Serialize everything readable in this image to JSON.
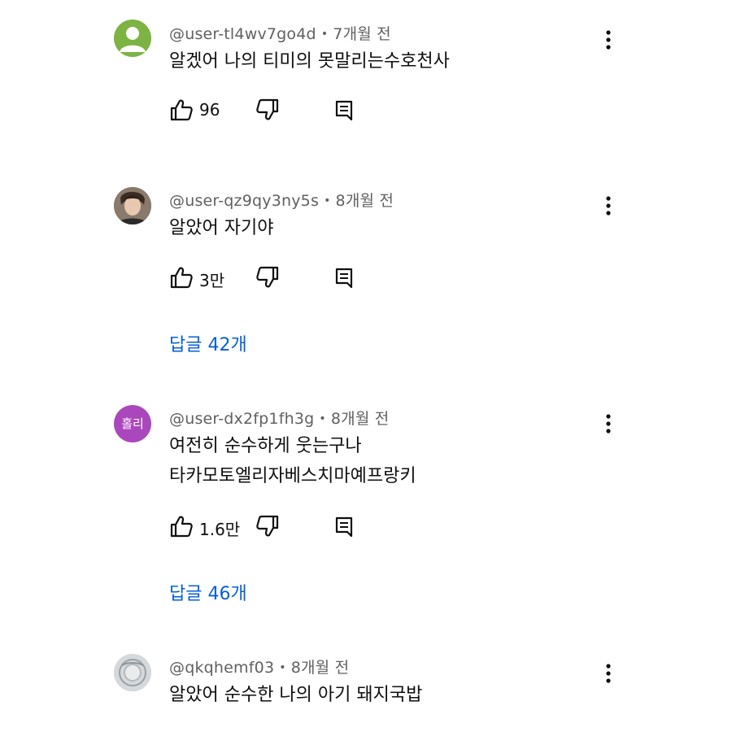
{
  "colors": {
    "link": "#065fd4",
    "meta": "#606060",
    "text": "#0f0f0f"
  },
  "comments": [
    {
      "username": "@user-tl4wv7go4d",
      "time": "7개월 전",
      "lines": [
        "알겠어 나의 티미의 못말리는수호천사"
      ],
      "likes": "96",
      "avatar": {
        "type": "default-person-icon",
        "color": "#7cb342"
      }
    },
    {
      "username": "@user-qz9qy3ny5s",
      "time": "8개월 전",
      "lines": [
        "알았어 자기야"
      ],
      "likes": "3만",
      "replies": "답글 42개",
      "avatar": {
        "type": "photo-avatar"
      }
    },
    {
      "username": "@user-dx2fp1fh3g",
      "time": "8개월 전",
      "lines": [
        "여전히 순수하게 웃는구나",
        "타카모토엘리자베스치마예프랑키"
      ],
      "likes": "1.6만",
      "replies": "답글 46개",
      "avatar": {
        "type": "text-avatar",
        "text": "홀리",
        "color": "#ab47bc"
      }
    },
    {
      "username": "@qkqhemf03",
      "time": "8개월 전",
      "lines": [
        "알았어 순수한 나의 아기 돼지국밥"
      ],
      "avatar": {
        "type": "photo-avatar"
      }
    }
  ],
  "icons": {
    "like": "thumbs-up-icon",
    "dislike": "thumbs-down-icon",
    "reply": "reply-icon",
    "more": "more-vertical-icon"
  }
}
